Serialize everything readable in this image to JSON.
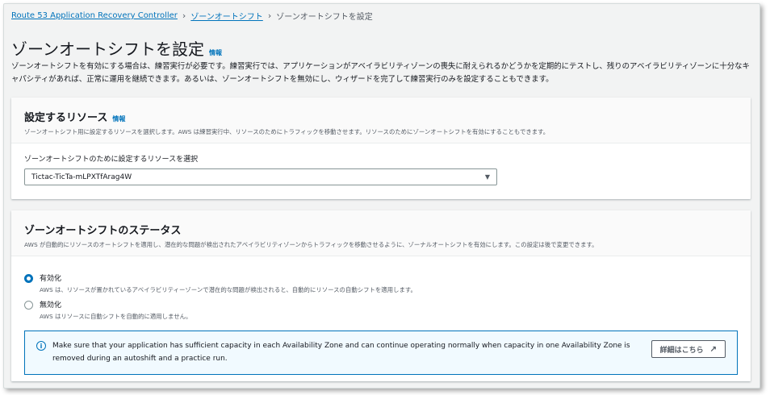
{
  "breadcrumb": {
    "items": [
      "Route 53 Application Recovery Controller",
      "ゾーンオートシフト"
    ],
    "current": "ゾーンオートシフトを設定"
  },
  "page": {
    "title": "ゾーンオートシフトを設定",
    "info": "情報",
    "description": "ゾーンオートシフトを有効にする場合は、練習実行が必要です。練習実行では、アプリケーションがアベイラビリティゾーンの喪失に耐えられるかどうかを定期的にテストし、残りのアベイラビリティゾーンに十分なキャパシティがあれば、正常に運用を継続できます。あるいは、ゾーンオートシフトを無効にし、ウィザードを完了して練習実行のみを設定することもできます。"
  },
  "resource_card": {
    "title": "設定するリソース",
    "info": "情報",
    "description": "ゾーンオートシフト用に設定するリソースを選択します。AWS は練習実行中、リソースのためにトラフィックを移動させます。リソースのためにゾーンオートシフトを有効にすることもできます。",
    "select_label": "ゾーンオートシフトのために設定するリソースを選択",
    "select_value": "Tictac-TicTa-mLPXTfArag4W"
  },
  "status_card": {
    "title": "ゾーンオートシフトのステータス",
    "description": "AWS が自動的にリソースのオートシフトを適用し、潜在的な問題が検出されたアベイラビリティゾーンからトラフィックを移動させるように、ゾーナルオートシフトを有効にします。この設定は後で変更できます。",
    "options": [
      {
        "label": "有効化",
        "desc": "AWS は、リソースが置かれているアベイラビリティーゾーンで潜在的な問題が検出されると、自動的にリソースの自動シフトを適用します。",
        "selected": true
      },
      {
        "label": "無効化",
        "desc": "AWS はリソースに自動シフトを自動的に適用しません。",
        "selected": false
      }
    ],
    "alert_text": "Make sure that your application has sufficient capacity in each Availability Zone and can continue operating normally when capacity in one Availability Zone is removed during an autoshift and a practice run.",
    "alert_button": "詳細はこちら"
  },
  "icons": {
    "info": "info-circle-icon",
    "external": "external-link-icon",
    "caret": "caret-down-icon",
    "chevron": "chevron-right-icon"
  },
  "colors": {
    "link": "#0073bb",
    "background": "#f2f3f3",
    "alert_bg": "#f1faff"
  }
}
